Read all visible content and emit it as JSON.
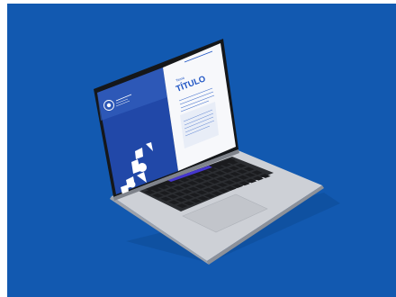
{
  "colors": {
    "background": "#1259b0",
    "white_frame": "#ffffff",
    "laptop_body": "#c9ccd2",
    "laptop_edge": "#9a9ea6",
    "keyboard_well": "#2b2d31",
    "key": "#1a1b1e",
    "screen_bezel": "#15171a",
    "slide_left_blue": "#2148a8",
    "slide_right_white": "#f7f8fb",
    "accent_blue": "#1f55c4",
    "touch_bar": "#3a3ad0"
  },
  "slide": {
    "title": "TÍTULO",
    "kicker": "Tema"
  },
  "icons": [
    "logo-seal-icon",
    "geometric-shapes-graphic"
  ]
}
